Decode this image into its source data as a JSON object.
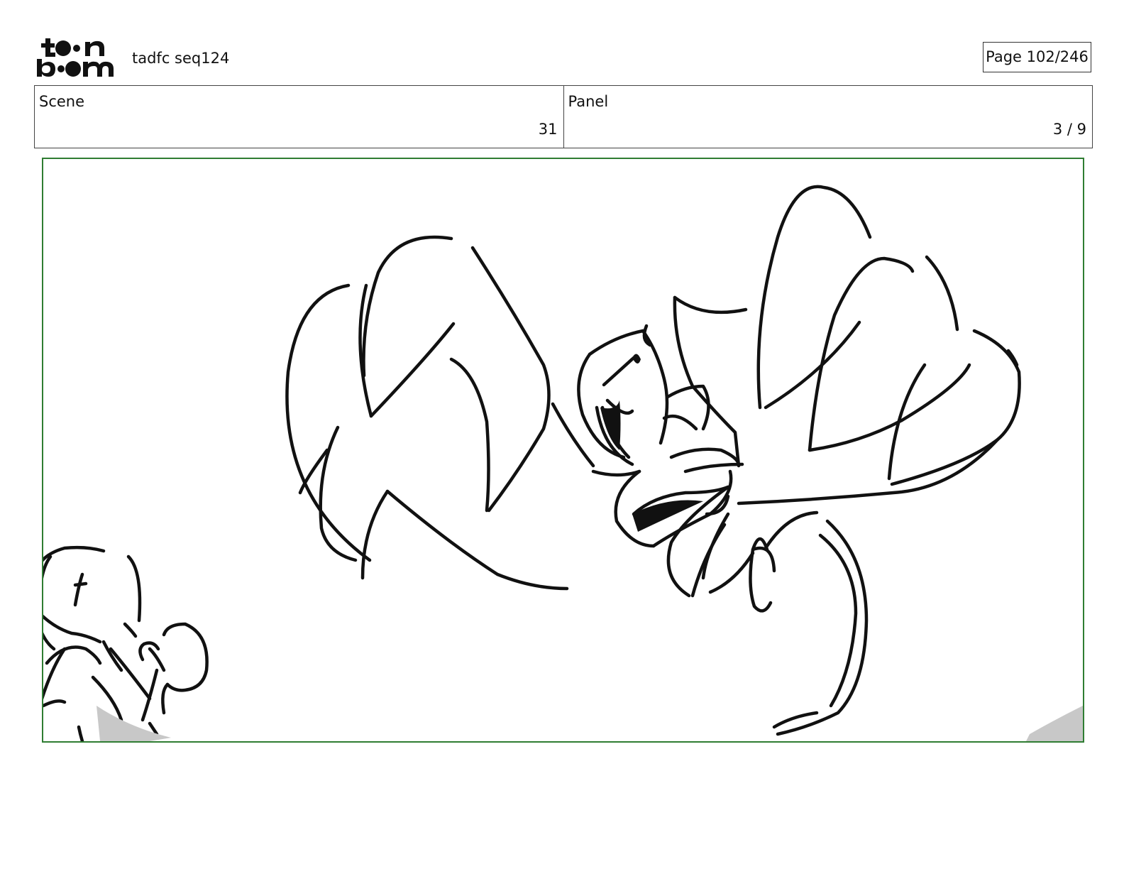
{
  "header": {
    "logo_top": "t●●n",
    "logo_bottom": "b●●m",
    "doc_title": "tadfc seq124",
    "page_indicator": "Page 102/246"
  },
  "info": {
    "scene_label": "Scene",
    "scene_value": "31",
    "panel_label": "Panel",
    "panel_value": "3 / 9"
  },
  "panel": {
    "frame_color": "#2f7d32",
    "art_icon": "storyboard-sketch"
  }
}
